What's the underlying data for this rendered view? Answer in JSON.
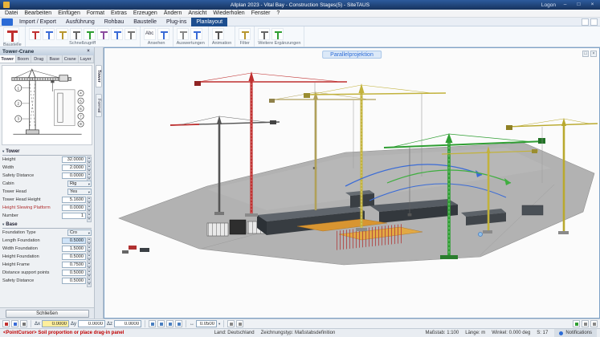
{
  "colors": {
    "titlebar": "#1b3a6b",
    "accent": "#2b6bd6",
    "crane_red": "#c03030",
    "crane_green": "#2f9e33",
    "crane_yellow": "#c2b23c",
    "crane_dark": "#555555",
    "ground": "#b2b2b2",
    "prompt": "#c00000",
    "highlight": "#cfe3f7",
    "active_field": "#ffef9c"
  },
  "icons": {
    "close": "×",
    "minimize": "–",
    "maximize": "□",
    "dropdown": "▾",
    "spin_up": "▲",
    "spin_down": "▼",
    "section_collapse": "▾",
    "snap_arrows": "↔",
    "help": "?",
    "restore": "□"
  },
  "window": {
    "title": "Allplan 2023 - Vital Bay - Construction Stages(5) - SiteTAUS",
    "logon_label": "Logon"
  },
  "menubar": {
    "items": [
      "Datei",
      "Bearbeiten",
      "Einfügen",
      "Format",
      "Extras",
      "Erzeugen",
      "Ändern",
      "Ansicht",
      "Wiederholen",
      "Fenster",
      "?"
    ]
  },
  "ribbon": {
    "tabs": [
      {
        "label": "Import / Export",
        "active": false
      },
      {
        "label": "Ausführung",
        "active": false
      },
      {
        "label": "Rohbau",
        "active": false
      },
      {
        "label": "Baustelle",
        "active": false
      },
      {
        "label": "Plug-ins",
        "active": false
      },
      {
        "label": "Planlayout",
        "active": true
      }
    ],
    "groups": [
      {
        "label": "Baustelle",
        "icons": [
          {
            "name": "site-crane-icon",
            "color": "#c03030",
            "big": true
          }
        ]
      },
      {
        "label": "Schnellzugriff",
        "icons": [
          {
            "name": "crane-red-icon",
            "color": "#c03030"
          },
          {
            "name": "crane-blue-icon",
            "color": "#3a6bd6"
          },
          {
            "name": "crane-yellow-icon",
            "color": "#b8962e"
          },
          {
            "name": "crane-gray-icon",
            "color": "#666666"
          },
          {
            "name": "crane-green-icon",
            "color": "#2f9e33"
          },
          {
            "name": "truck-icon",
            "color": "#8a4a9e"
          },
          {
            "name": "excavator-icon",
            "color": "#3a6bd6"
          },
          {
            "name": "container-icon",
            "color": "#777777"
          }
        ]
      },
      {
        "label": "Ansehen",
        "icons": [
          {
            "name": "abc-icon",
            "text": "Abc"
          },
          {
            "name": "measure-icon",
            "color": "#3a6bd6"
          }
        ]
      },
      {
        "label": "Auswertungen",
        "icons": [
          {
            "name": "report-icon",
            "color": "#888888"
          },
          {
            "name": "table-icon",
            "color": "#3a6bd6"
          }
        ]
      },
      {
        "label": "Animation",
        "icons": [
          {
            "name": "camera-icon",
            "color": "#555555"
          }
        ]
      },
      {
        "label": "Filter",
        "icons": [
          {
            "name": "filter-icon",
            "color": "#b8962e"
          }
        ]
      },
      {
        "label": "Weitere Ergänzungen",
        "icons": [
          {
            "name": "gear-icon",
            "color": "#666666"
          },
          {
            "name": "plus-icon",
            "color": "#2f9e33"
          }
        ]
      }
    ]
  },
  "palette": {
    "title": "Tower-Crane",
    "tabs": [
      "Tower",
      "Boom",
      "Drag",
      "Base",
      "Crane",
      "Layer"
    ],
    "side_tabs": [
      "Tower",
      "Format"
    ],
    "close_button": "Schließen",
    "sections": [
      {
        "title": "Tower",
        "rows": [
          {
            "label": "Height",
            "value": "32.0000",
            "type": "spin"
          },
          {
            "label": "Width",
            "value": "2.0000",
            "type": "spin"
          },
          {
            "label": "Safety Distance",
            "value": "0.0000",
            "type": "spin"
          },
          {
            "label": "Cabin",
            "value": "Rig",
            "type": "dropdown"
          },
          {
            "label": "Tower Head",
            "value": "Yes",
            "type": "dropdown"
          },
          {
            "label": "Tower Head Height",
            "value": "5.1600",
            "type": "spin"
          },
          {
            "label": "Height Slewing Platform",
            "value": "0.0000",
            "type": "spin",
            "label_color": "#b03030"
          },
          {
            "label": "Number",
            "value": "1",
            "type": "spin"
          }
        ]
      },
      {
        "title": "Base",
        "rows": [
          {
            "label": "Foundation Type",
            "value": "Cro",
            "type": "dropdown"
          },
          {
            "label": "Length Foundation",
            "value": "0.5000",
            "type": "spin",
            "highlight": true
          },
          {
            "label": "Width Foundation",
            "value": "1.5000",
            "type": "spin"
          },
          {
            "label": "Height Foundation",
            "value": "0.5000",
            "type": "spin"
          },
          {
            "label": "Height Frame",
            "value": "0.7500",
            "type": "spin"
          },
          {
            "label": "Distance support points",
            "value": "0.5000",
            "type": "spin"
          },
          {
            "label": "Safety Distance",
            "value": "0.5000",
            "type": "spin"
          }
        ]
      }
    ],
    "diagram_numbers": [
      "1",
      "2",
      "3",
      "4",
      "5",
      "6",
      "7",
      "8"
    ]
  },
  "viewport": {
    "title": "Parallelprojektion"
  },
  "coordrow": {
    "dx_label": "Δx",
    "dy_label": "Δy",
    "dz_label": "Δz",
    "dx": "0.0000",
    "dy": "0.0000",
    "dz": "0.0000",
    "snap": "0.0500"
  },
  "statusbar": {
    "prompt": "<PointCursor> Soil proportion or place drag-in panel",
    "country": "Land: Deutschland",
    "drawing_type": "Zeichnungstyp: Maßstabsdefinition",
    "right_items": [
      "Maßstab: 1:100",
      "Länge: m",
      "Winkel: 0.000 deg",
      "S: 17"
    ],
    "notifications": "Notifications"
  }
}
